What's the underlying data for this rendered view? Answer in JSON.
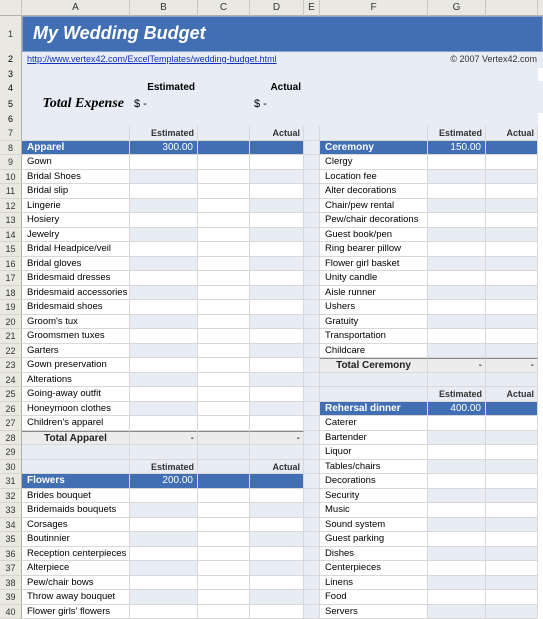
{
  "cols": [
    "",
    "A",
    "B",
    "C",
    "D",
    "E",
    "F",
    "G"
  ],
  "title": "My Wedding Budget",
  "link": "http://www.vertex42.com/ExcelTemplates/wedding-budget.html",
  "copyright": "© 2007 Vertex42.com",
  "summary": {
    "est_label": "Estimated",
    "act_label": "Actual",
    "total_label": "Total Expense",
    "est_val": "$    -",
    "act_val": "$    -"
  },
  "hdr_est": "Estimated",
  "hdr_act": "Actual",
  "apparel": {
    "name": "Apparel",
    "amount": "300.00",
    "items": [
      "Gown",
      "Bridal Shoes",
      "Bridal slip",
      "Lingerie",
      "Hosiery",
      "Jewelry",
      "Bridal Headpice/veil",
      "Bridal gloves",
      "Bridesmaid dresses",
      "Bridesmaid accessories",
      "Bridesmaid shoes",
      "Groom's tux",
      "Groomsmen tuxes",
      "Garters",
      "Gown preservation",
      "Alterations",
      "Going-away outfit",
      "Honeymoon clothes",
      "Children's apparel"
    ],
    "total_label": "Total Apparel",
    "total_est": "-",
    "total_act": "-"
  },
  "flowers": {
    "name": "Flowers",
    "amount": "200.00",
    "items": [
      "Brides bouquet",
      "Bridemaids bouquets",
      "Corsages",
      "Boutinnier",
      "Reception centerpieces",
      "Alterpiece",
      "Pew/chair bows",
      "Throw away bouquet",
      "Flower girls' flowers"
    ]
  },
  "ceremony": {
    "name": "Ceremony",
    "amount": "150.00",
    "items": [
      "Clergy",
      "Location fee",
      "Alter decorations",
      "Chair/pew rental",
      "Pew/chair decorations",
      "Guest book/pen",
      "Ring bearer pillow",
      "Flower girl basket",
      "Unity candle",
      "Aisle runner",
      "Ushers",
      "Gratuity",
      "Transportation",
      "Childcare"
    ],
    "total_label": "Total Ceremony",
    "total_est": "-",
    "total_act": "-"
  },
  "rehearsal": {
    "name": "Rehersal dinner",
    "amount": "400.00",
    "items": [
      "Caterer",
      "Bartender",
      "Liquor",
      "Tables/chairs",
      "Decorations",
      "Security",
      "Music",
      "Sound system",
      "Guest parking",
      "Dishes",
      "Centerpieces",
      "Linens",
      "Food",
      "Servers"
    ]
  }
}
